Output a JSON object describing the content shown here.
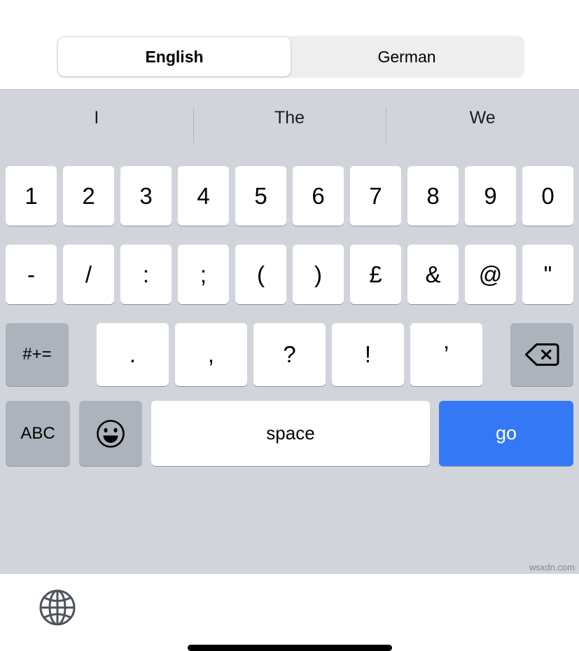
{
  "language_bar": {
    "segments": [
      {
        "label": "English",
        "selected": true
      },
      {
        "label": "German",
        "selected": false
      }
    ]
  },
  "keyboard": {
    "predictions": [
      "I",
      "The",
      "We"
    ],
    "rows": {
      "numbers": [
        "1",
        "2",
        "3",
        "4",
        "5",
        "6",
        "7",
        "8",
        "9",
        "0"
      ],
      "symbols": [
        "-",
        "/",
        ":",
        ";",
        "(",
        ")",
        "£",
        "&",
        "@",
        "\""
      ],
      "punctuation": {
        "modifier_label": "#+=",
        "keys": [
          ".",
          ",",
          "?",
          "!",
          "’"
        ],
        "delete_icon": "delete-backspace-icon"
      },
      "bottom": {
        "abc_label": "ABC",
        "emoji_icon": "smiley-face-icon",
        "space_label": "space",
        "go_label": "go"
      }
    },
    "globe_icon": "globe-icon",
    "home_indicator": "home-indicator-bar"
  },
  "watermark": "wsxdn.com",
  "colors": {
    "keyboard_background": "#d1d5db",
    "key_light": "#ffffff",
    "key_dark": "#adb3bc",
    "accent_blue": "#3478f6",
    "text_primary": "#000000",
    "separator": "#b3b8c0"
  }
}
